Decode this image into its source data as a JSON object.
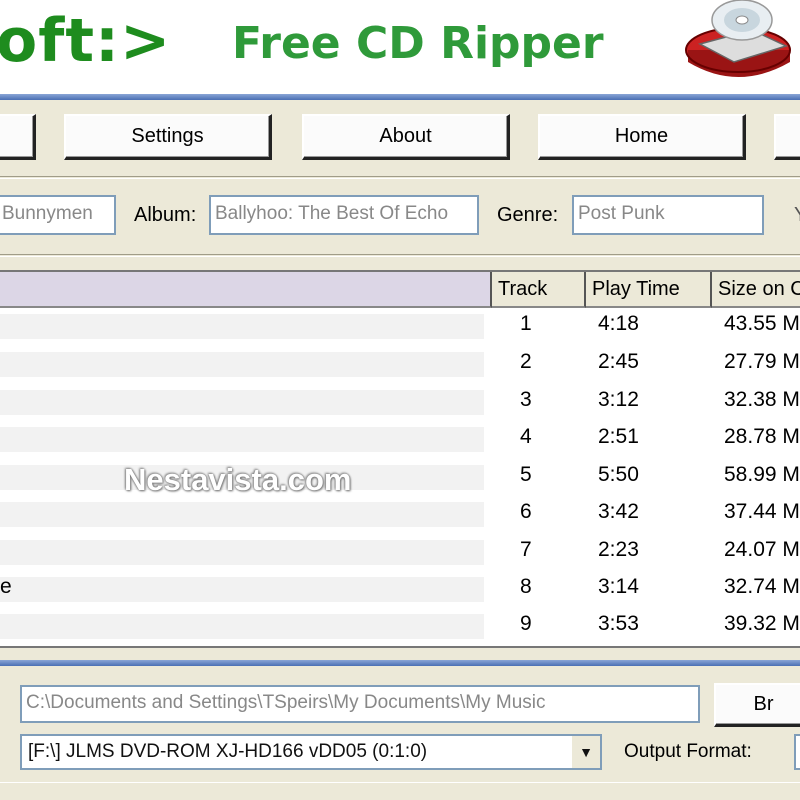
{
  "header": {
    "brand": "oft:>",
    "title": "Free CD Ripper",
    "logo_icon": "cd-drive-icon",
    "brand_color": "#1e8c1e",
    "title_color": "#2f9a3a"
  },
  "toolbar": {
    "settings_label": "Settings",
    "about_label": "About",
    "home_label": "Home"
  },
  "tags": {
    "artist_value": "Bunnymen",
    "album_label": "Album:",
    "album_value": "Ballyhoo: The Best Of Echo",
    "genre_label": "Genre:",
    "genre_value": "Post Punk"
  },
  "table": {
    "columns": [
      "Track",
      "Play Time",
      "Size on C"
    ],
    "rows": [
      {
        "title": "",
        "track": "1",
        "time": "4:18",
        "size": "43.55 M"
      },
      {
        "title": "",
        "track": "2",
        "time": "2:45",
        "size": "27.79 M"
      },
      {
        "title": "",
        "track": "3",
        "time": "3:12",
        "size": "32.38 M"
      },
      {
        "title": "",
        "track": "4",
        "time": "2:51",
        "size": "28.78 M"
      },
      {
        "title": "",
        "track": "5",
        "time": "5:50",
        "size": "58.99 M"
      },
      {
        "title": "",
        "track": "6",
        "time": "3:42",
        "size": "37.44 M"
      },
      {
        "title": "",
        "track": "7",
        "time": "2:23",
        "size": "24.07 M"
      },
      {
        "title": "e",
        "track": "8",
        "time": "3:14",
        "size": "32.74 M"
      },
      {
        "title": "",
        "track": "9",
        "time": "3:53",
        "size": "39.32 M"
      }
    ]
  },
  "watermark": "Nestavista.com",
  "output": {
    "path_value": "C:\\Documents and Settings\\TSpeirs\\My Documents\\My Music",
    "browse_label": "Br",
    "drive_value": "[F:\\]   JLMS DVD-ROM XJ-HD166 vDD05 (0:1:0)",
    "format_label": "Output Format:",
    "dropdown_icon": "dropdown-arrow-icon"
  }
}
